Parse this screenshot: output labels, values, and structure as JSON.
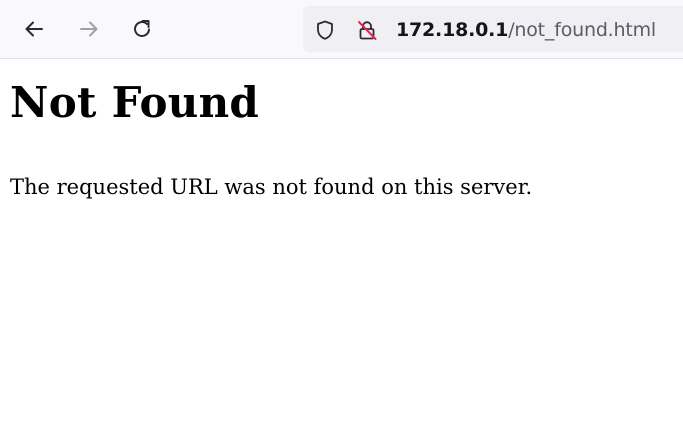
{
  "browser": {
    "url": {
      "host": "172.18.0.1",
      "path": "/not_found.html"
    },
    "icons": {
      "back": "arrow-left-icon",
      "forward": "arrow-right-icon",
      "reload": "reload-icon",
      "tracking_protection": "shield-icon",
      "connection": "insecure-lock-icon"
    },
    "colors": {
      "insecure_lock_slash": "#e22850",
      "forward_disabled": "#a0a0a8"
    }
  },
  "page": {
    "heading": "Not Found",
    "message": "The requested URL was not found on this server."
  }
}
